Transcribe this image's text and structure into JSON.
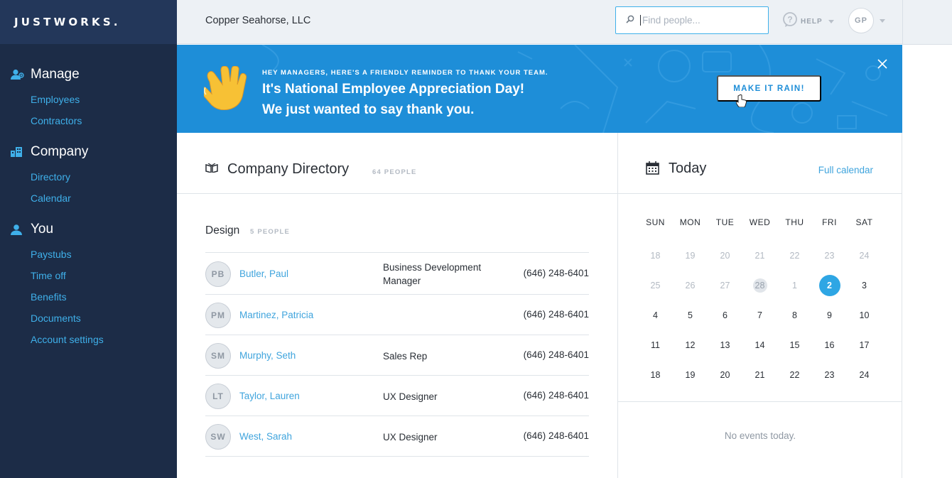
{
  "sidebar": {
    "logo": "JUSTWORKS.",
    "sections": [
      {
        "title": "Manage",
        "icon": "manage-users-icon",
        "items": [
          "Employees",
          "Contractors"
        ]
      },
      {
        "title": "Company",
        "icon": "building-icon",
        "items": [
          "Directory",
          "Calendar"
        ]
      },
      {
        "title": "You",
        "icon": "person-icon",
        "items": [
          "Paystubs",
          "Time off",
          "Benefits",
          "Documents",
          "Account settings"
        ]
      }
    ]
  },
  "topbar": {
    "company": "Copper Seahorse, LLC",
    "search_placeholder": "Find people...",
    "help_label": "HELP",
    "user_initials": "GP"
  },
  "banner": {
    "kicker": "HEY MANAGERS, HERE'S A FRIENDLY REMINDER TO THANK YOUR TEAM.",
    "line1": "It's National Employee Appreciation Day!",
    "line2": "We just wanted to say thank you.",
    "button": "MAKE IT RAIN!",
    "color": "#1e8ed8"
  },
  "directory": {
    "title": "Company Directory",
    "count": "64 PEOPLE",
    "group": {
      "name": "Design",
      "count": "5 PEOPLE",
      "people": [
        {
          "initials": "PB",
          "name": "Butler, Paul",
          "title": "Business Development Manager",
          "phone": "(646) 248-6401"
        },
        {
          "initials": "PM",
          "name": "Martinez, Patricia",
          "title": "",
          "phone": "(646) 248-6401"
        },
        {
          "initials": "SM",
          "name": "Murphy, Seth",
          "title": "Sales Rep",
          "phone": "(646) 248-6401"
        },
        {
          "initials": "LT",
          "name": "Taylor, Lauren",
          "title": "UX Designer",
          "phone": "(646) 248-6401"
        },
        {
          "initials": "SW",
          "name": "West, Sarah",
          "title": "UX Designer",
          "phone": "(646) 248-6401"
        }
      ]
    }
  },
  "today": {
    "title": "Today",
    "full_calendar": "Full calendar",
    "weekdays": [
      "SUN",
      "MON",
      "TUE",
      "WED",
      "THU",
      "FRI",
      "SAT"
    ],
    "weeks": [
      [
        "18",
        "19",
        "20",
        "21",
        "22",
        "23",
        "24"
      ],
      [
        "25",
        "26",
        "27",
        "28",
        "1",
        "2",
        "3"
      ],
      [
        "4",
        "5",
        "6",
        "7",
        "8",
        "9",
        "10"
      ],
      [
        "11",
        "12",
        "13",
        "14",
        "15",
        "16",
        "17"
      ],
      [
        "18",
        "19",
        "20",
        "21",
        "22",
        "23",
        "24"
      ]
    ],
    "current_day": "2",
    "no_events": "No events today.",
    "accent": "#2ea6e4"
  }
}
